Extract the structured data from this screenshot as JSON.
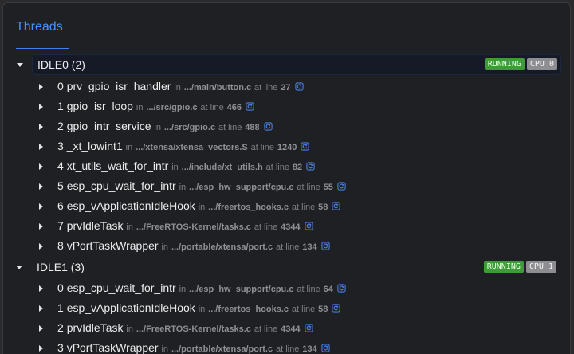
{
  "title": "Threads",
  "colors": {
    "accent": "#4d8ff7",
    "running": "#3f9b3a",
    "cpu": "#8e8e92"
  },
  "icons": {
    "expanded": "caret-down-icon",
    "collapsed": "caret-right-icon",
    "source": "source-link-icon"
  },
  "threads": [
    {
      "label": "IDLE0 (2)",
      "status": "RUNNING",
      "cpu": "CPU 0",
      "frames": [
        {
          "index": "0",
          "name": "prv_gpio_isr_handler",
          "in": "in",
          "path": ".../main/button.c",
          "at": "at line",
          "line": "27"
        },
        {
          "index": "1",
          "name": "gpio_isr_loop",
          "in": "in",
          "path": ".../src/gpio.c",
          "at": "at line",
          "line": "466"
        },
        {
          "index": "2",
          "name": "gpio_intr_service",
          "in": "in",
          "path": ".../src/gpio.c",
          "at": "at line",
          "line": "488"
        },
        {
          "index": "3",
          "name": "_xt_lowint1",
          "in": "in",
          "path": ".../xtensa/xtensa_vectors.S",
          "at": "at line",
          "line": "1240"
        },
        {
          "index": "4",
          "name": "xt_utils_wait_for_intr",
          "in": "in",
          "path": ".../include/xt_utils.h",
          "at": "at line",
          "line": "82"
        },
        {
          "index": "5",
          "name": "esp_cpu_wait_for_intr",
          "in": "in",
          "path": ".../esp_hw_support/cpu.c",
          "at": "at line",
          "line": "55"
        },
        {
          "index": "6",
          "name": "esp_vApplicationIdleHook",
          "in": "in",
          "path": ".../freertos_hooks.c",
          "at": "at line",
          "line": "58"
        },
        {
          "index": "7",
          "name": "prvIdleTask",
          "in": "in",
          "path": ".../FreeRTOS-Kernel/tasks.c",
          "at": "at line",
          "line": "4344"
        },
        {
          "index": "8",
          "name": "vPortTaskWrapper",
          "in": "in",
          "path": ".../portable/xtensa/port.c",
          "at": "at line",
          "line": "134"
        }
      ]
    },
    {
      "label": "IDLE1 (3)",
      "status": "RUNNING",
      "cpu": "CPU 1",
      "frames": [
        {
          "index": "0",
          "name": "esp_cpu_wait_for_intr",
          "in": "in",
          "path": ".../esp_hw_support/cpu.c",
          "at": "at line",
          "line": "64"
        },
        {
          "index": "1",
          "name": "esp_vApplicationIdleHook",
          "in": "in",
          "path": ".../freertos_hooks.c",
          "at": "at line",
          "line": "58"
        },
        {
          "index": "2",
          "name": "prvIdleTask",
          "in": "in",
          "path": ".../FreeRTOS-Kernel/tasks.c",
          "at": "at line",
          "line": "4344"
        },
        {
          "index": "3",
          "name": "vPortTaskWrapper",
          "in": "in",
          "path": ".../portable/xtensa/port.c",
          "at": "at line",
          "line": "134"
        }
      ]
    }
  ]
}
